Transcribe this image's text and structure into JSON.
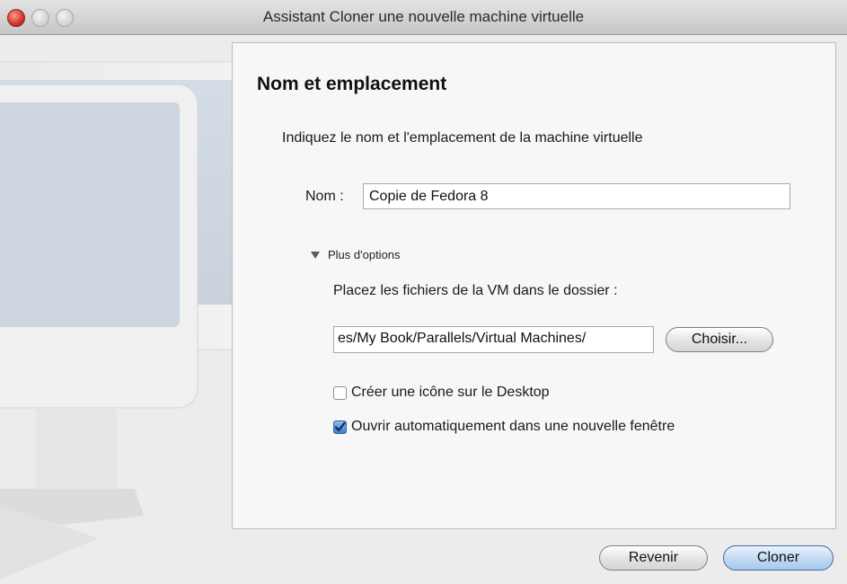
{
  "window": {
    "title": "Assistant Cloner une nouvelle machine virtuelle"
  },
  "content": {
    "heading": "Nom et emplacement",
    "instruction": "Indiquez le nom et l'emplacement de la machine virtuelle",
    "name_label": "Nom :",
    "name_value": "Copie de Fedora 8",
    "more_options": "Plus d'options",
    "folder_label": "Placez les fichiers de la VM dans le dossier :",
    "folder_path_visible": "es/My Book/Parallels/Virtual Machines/",
    "choose_button": "Choisir...",
    "create_icon": {
      "label": "Créer une icône sur le Desktop",
      "checked": false
    },
    "open_auto": {
      "label": "Ouvrir automatiquement dans une nouvelle fenêtre",
      "checked": true
    }
  },
  "footer": {
    "back_button": "Revenir",
    "clone_button": "Cloner"
  },
  "colors": {
    "accent": "#3a7fd0",
    "close_button": "#d0322a"
  }
}
